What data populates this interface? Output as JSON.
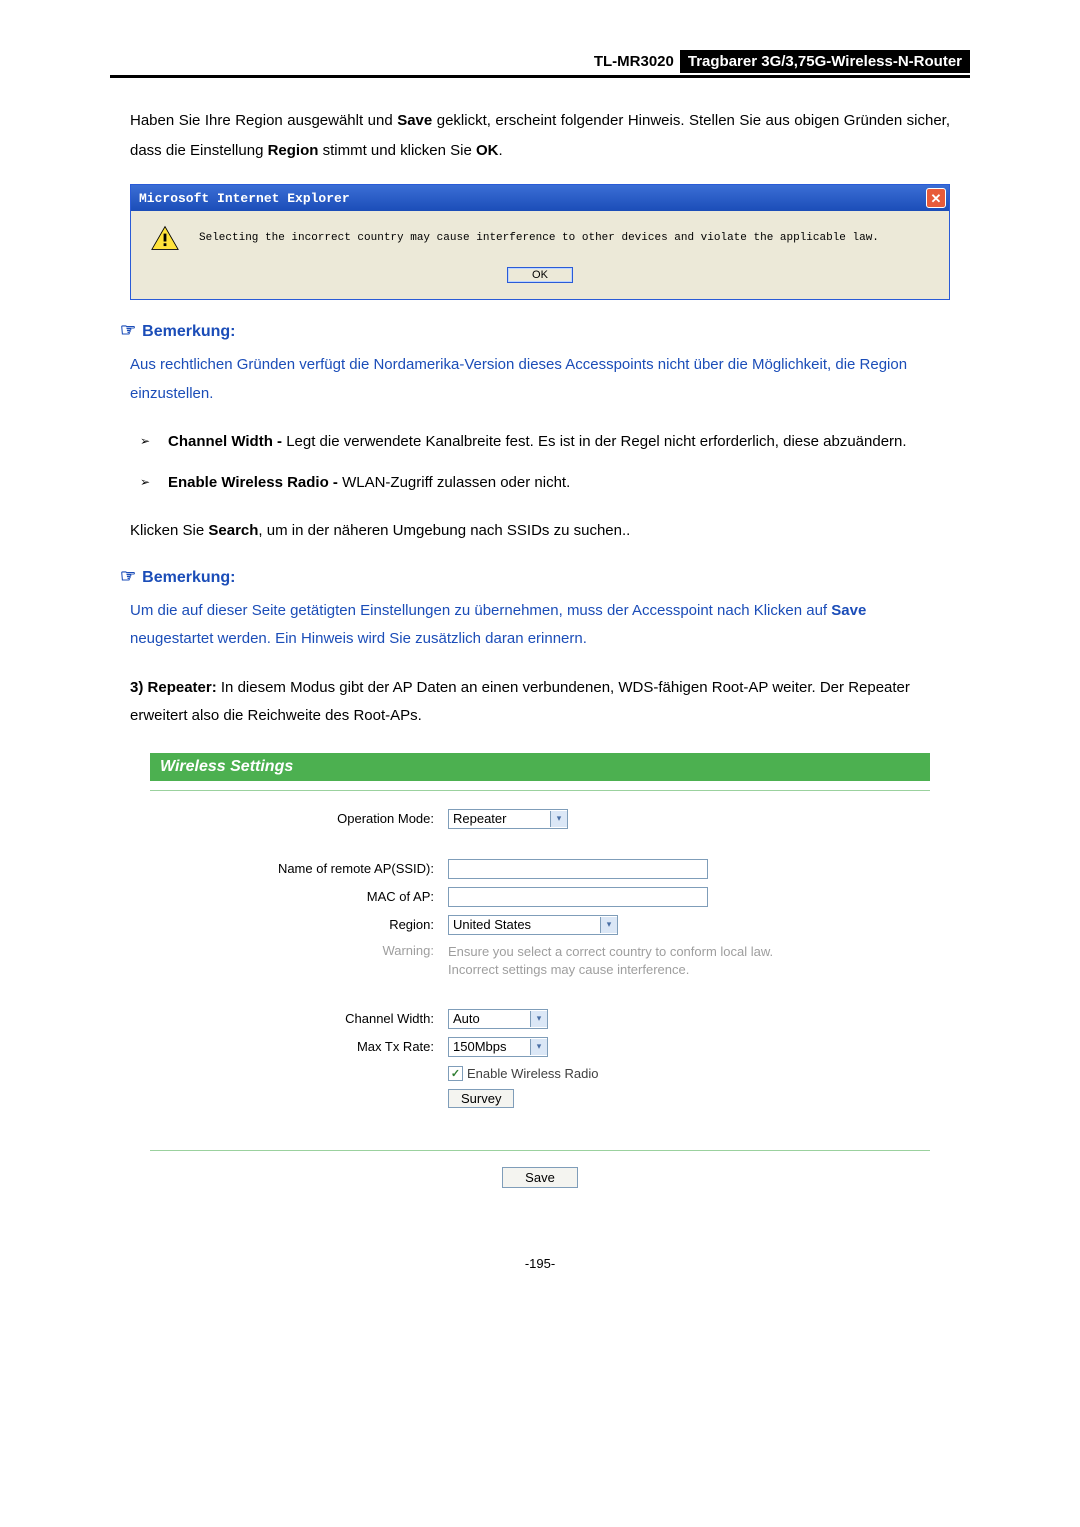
{
  "header": {
    "model": "TL-MR3020",
    "desc": "Tragbarer 3G/3,75G-Wireless-N-Router"
  },
  "intro": {
    "line1_pre": "Haben Sie Ihre Region ausgewählt und ",
    "line1_bold1": "Save",
    "line1_mid": " geklickt, erscheint folgender Hinweis. Stellen Sie aus obigen Gründen sicher, dass die Einstellung ",
    "line1_bold2": "Region",
    "line1_post": " stimmt und klicken Sie ",
    "line1_bold3": "OK",
    "line1_end": "."
  },
  "dialog": {
    "title": "Microsoft Internet Explorer",
    "message": "Selecting the incorrect country may cause interference to other devices and violate the applicable law.",
    "ok": "OK"
  },
  "note1": {
    "heading": "Bemerkung:",
    "body": "Aus rechtlichen Gründen verfügt die Nordamerika-Version dieses Accesspoints nicht über die Möglichkeit, die Region einzustellen."
  },
  "bullets": {
    "b1_bold": "Channel Width - ",
    "b1_text": "Legt die verwendete Kanalbreite fest. Es ist in der Regel nicht erforderlich, diese abzuändern.",
    "b2_bold": "Enable Wireless Radio - ",
    "b2_text": "WLAN-Zugriff zulassen oder nicht."
  },
  "search_para_pre": "Klicken Sie ",
  "search_para_bold": "Search",
  "search_para_post": ", um in der näheren Umgebung nach SSIDs zu suchen..",
  "note2": {
    "heading": "Bemerkung:",
    "body_pre": "Um die auf dieser Seite getätigten Einstellungen zu übernehmen, muss der Accesspoint nach Klicken auf ",
    "body_bold": "Save",
    "body_post": " neugestartet werden. Ein Hinweis wird Sie zusätzlich daran erinnern."
  },
  "item3": {
    "num": "3)",
    "title": "Repeater:",
    "text1": " In diesem Modus gibt der AP Daten an einen verbundenen, WDS-fähigen Root-AP weiter. Der Repeater erweitert also die Reichweite des Root-APs."
  },
  "ws": {
    "title": "Wireless Settings",
    "labels": {
      "opmode": "Operation Mode:",
      "ssid": "Name of remote AP(SSID):",
      "mac": "MAC of AP:",
      "region": "Region:",
      "warning": "Warning:",
      "chwidth": "Channel Width:",
      "maxtx": "Max Tx Rate:"
    },
    "values": {
      "opmode": "Repeater",
      "ssid": "",
      "mac": "",
      "region": "United States",
      "warning_l1": "Ensure you select a correct country to conform local law.",
      "warning_l2": "Incorrect settings may cause interference.",
      "chwidth": "Auto",
      "maxtx": "150Mbps",
      "enable_radio": "Enable Wireless Radio",
      "survey": "Survey",
      "save": "Save"
    }
  },
  "page_number": "-195-"
}
